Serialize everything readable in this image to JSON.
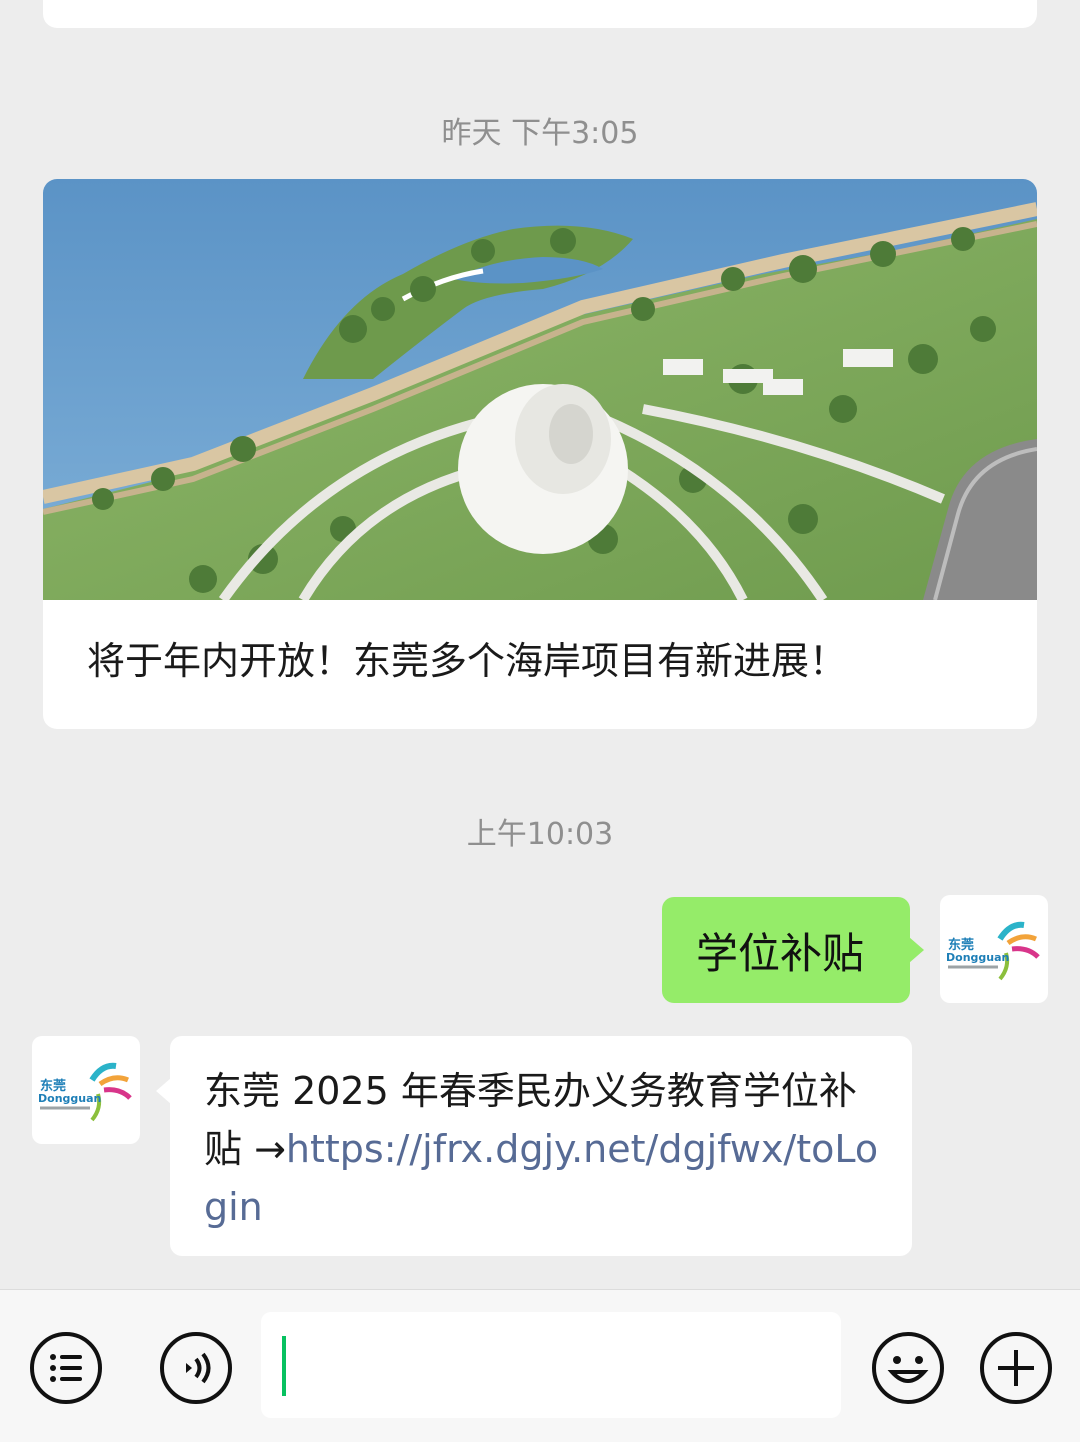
{
  "chat": {
    "timestamps": [
      "昨天 下午3:05",
      "上午10:03"
    ],
    "article": {
      "title": "将于年内开放！东莞多个海岸项目有新进展！",
      "image": "seaside-park-rendering"
    },
    "messages": [
      {
        "direction": "outgoing",
        "text": "学位补贴",
        "avatar": "dongguan-logo"
      },
      {
        "direction": "incoming",
        "text": "东莞 2025 年春季民办义务教育学位补贴 →",
        "link": "https://jfrx.dgjy.net/dgjfwx/toLogin",
        "avatar": "dongguan-logo"
      }
    ],
    "avatar_logo": {
      "cn": "东莞",
      "en": "Dongguan"
    }
  },
  "toolbar": {
    "input_value": "",
    "icons": [
      "menu-icon",
      "voice-icon",
      "emoji-icon",
      "plus-icon"
    ]
  },
  "colors": {
    "background": "#ededed",
    "outgoing_bubble": "#95ec69",
    "incoming_bubble": "#ffffff",
    "link": "#576b95",
    "cursor": "#07c160"
  }
}
